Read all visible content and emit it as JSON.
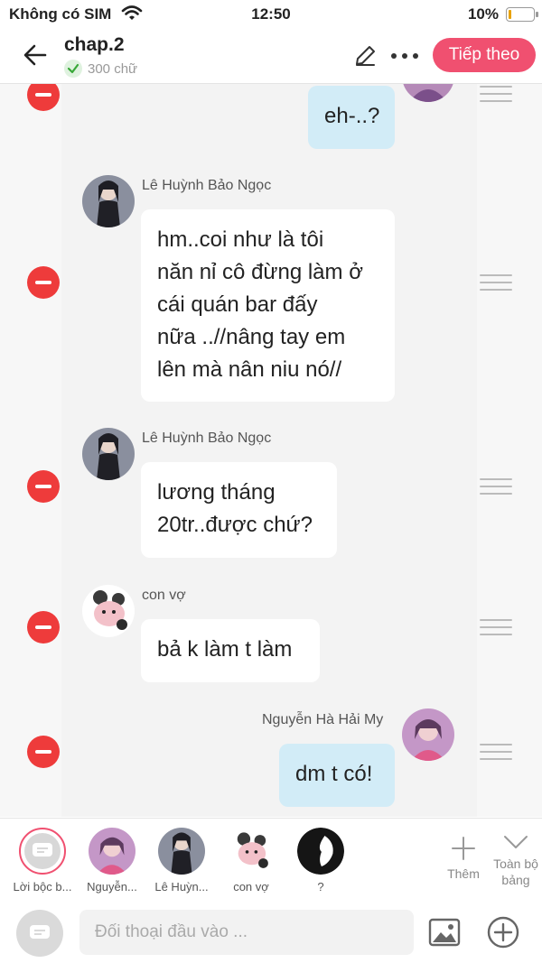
{
  "status": {
    "carrier": "Không có SIM",
    "time": "12:50",
    "battery": "10%",
    "battery_level": 0.1
  },
  "header": {
    "title": "chap.2",
    "word_count": "300 chữ",
    "next_label": "Tiếp theo"
  },
  "messages": [
    {
      "side": "right",
      "speaker": "",
      "text": "eh-..?"
    },
    {
      "side": "left",
      "speaker": "Lê Huỳnh Bảo Ngọc",
      "lines": [
        "hm..coi như là tôi",
        "năn nỉ cô đừng làm ở",
        "cái quán bar đấy",
        "nữa ..//nâng tay em",
        "lên mà nân niu nó//"
      ]
    },
    {
      "side": "left",
      "speaker": "Lê Huỳnh Bảo Ngọc",
      "lines": [
        "lương tháng",
        "20tr..được chứ?"
      ]
    },
    {
      "side": "left",
      "speaker": "con vợ",
      "text": "bả k làm t làm"
    },
    {
      "side": "right",
      "speaker": "Nguyễn Hà Hải My",
      "text": "dm t có!"
    }
  ],
  "characters": [
    {
      "label": "Lời bộc b...",
      "icon": "narration-icon"
    },
    {
      "label": "Nguyễn...",
      "icon": "avatar-pink"
    },
    {
      "label": "Lê Huỳn...",
      "icon": "avatar-dark"
    },
    {
      "label": "con vợ",
      "icon": "avatar-sheep"
    },
    {
      "label": "?",
      "icon": "avatar-silhouette"
    }
  ],
  "toolbar": {
    "add_label": "Thêm",
    "all_board_label": "Toàn bộ bảng"
  },
  "input": {
    "placeholder": "Đối thoại đầu vào ..."
  },
  "colors": {
    "accent": "#f05070",
    "delete": "#ee3b3b",
    "right_bubble": "#d2ecf7"
  }
}
